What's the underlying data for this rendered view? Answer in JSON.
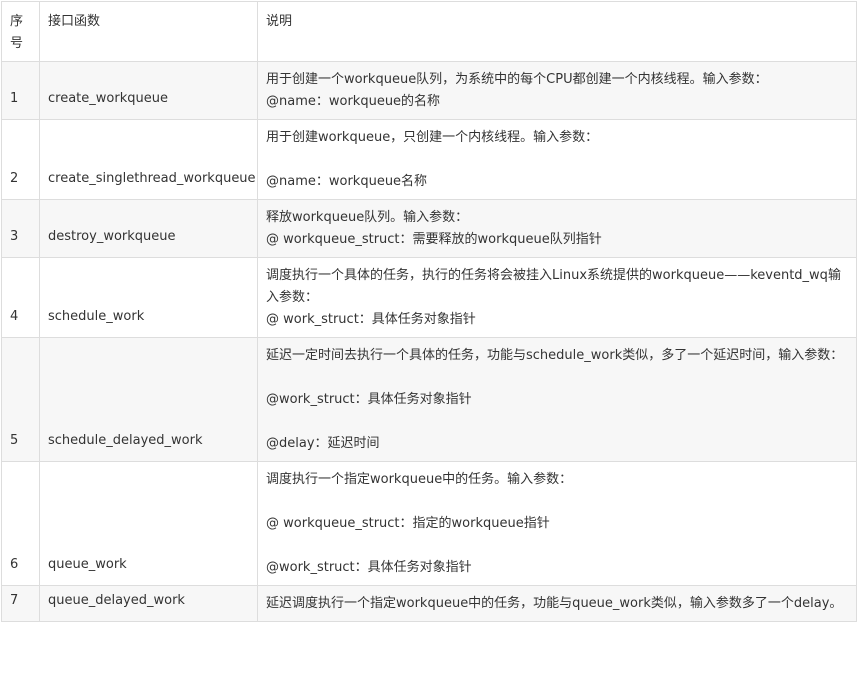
{
  "table": {
    "headers": {
      "number_line1": "序",
      "number_line2": "号",
      "function": "接口函数",
      "description": "说明"
    },
    "rows": [
      {
        "number": "1",
        "function": "create_workqueue",
        "description": [
          "用于创建一个workqueue队列，为系统中的每个CPU都创建一个内核线程。输入参数：",
          "@name：workqueue的名称"
        ]
      },
      {
        "number": "2",
        "function": "create_singlethread_workqueue",
        "description": [
          "用于创建workqueue，只创建一个内核线程。输入参数：",
          "",
          "@name：workqueue名称"
        ]
      },
      {
        "number": "3",
        "function": "destroy_workqueue",
        "description": [
          "释放workqueue队列。输入参数：",
          "@ workqueue_struct：需要释放的workqueue队列指针"
        ]
      },
      {
        "number": "4",
        "function": "schedule_work",
        "description": [
          "调度执行一个具体的任务，执行的任务将会被挂入Linux系统提供的workqueue——keventd_wq输入参数：",
          "@ work_struct：具体任务对象指针"
        ]
      },
      {
        "number": "5",
        "function": "schedule_delayed_work",
        "description": [
          "延迟一定时间去执行一个具体的任务，功能与schedule_work类似，多了一个延迟时间，输入参数：",
          "",
          "@work_struct：具体任务对象指针",
          "",
          "@delay：延迟时间"
        ]
      },
      {
        "number": "6",
        "function": "queue_work",
        "description": [
          "调度执行一个指定workqueue中的任务。输入参数：",
          "",
          "@ workqueue_struct：指定的workqueue指针",
          "",
          "@work_struct：具体任务对象指针"
        ]
      },
      {
        "number": "7",
        "function": "queue_delayed_work",
        "description": [
          "延迟调度执行一个指定workqueue中的任务，功能与queue_work类似，输入参数多了一个delay。"
        ]
      }
    ]
  }
}
